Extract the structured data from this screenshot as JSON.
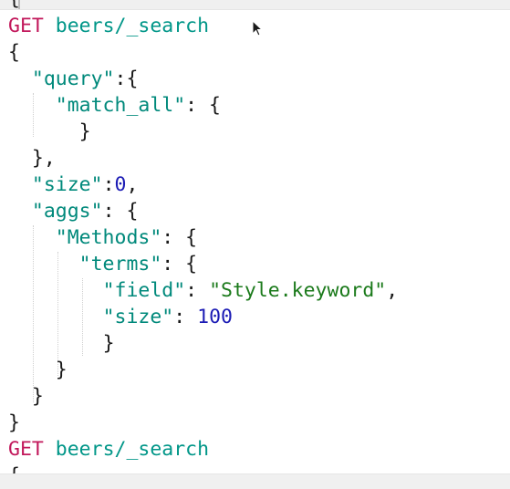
{
  "editor": {
    "request": {
      "method": "GET",
      "url": "beers/_search"
    },
    "code": {
      "open_root": "{",
      "query_key": "\"query\"",
      "query_open": ":{",
      "match_all_key": "\"match_all\"",
      "match_all_open": ": {",
      "match_all_close": "}",
      "query_close": "},",
      "size_key": "\"size\"",
      "size_value": "0",
      "aggs_key": "\"aggs\"",
      "aggs_open": ": {",
      "methods_key": "\"Methods\"",
      "methods_open": ": {",
      "terms_key": "\"terms\"",
      "terms_open": ": {",
      "field_key": "\"field\"",
      "field_value": "\"Style.keyword\"",
      "terms_size_key": "\"size\"",
      "terms_size_value": "100",
      "terms_close": "}",
      "methods_close": "}",
      "aggs_close": "}",
      "close_root": "}"
    },
    "next_request": {
      "method": "GET",
      "url": "beers/_search"
    },
    "clipped_brace": "{"
  }
}
